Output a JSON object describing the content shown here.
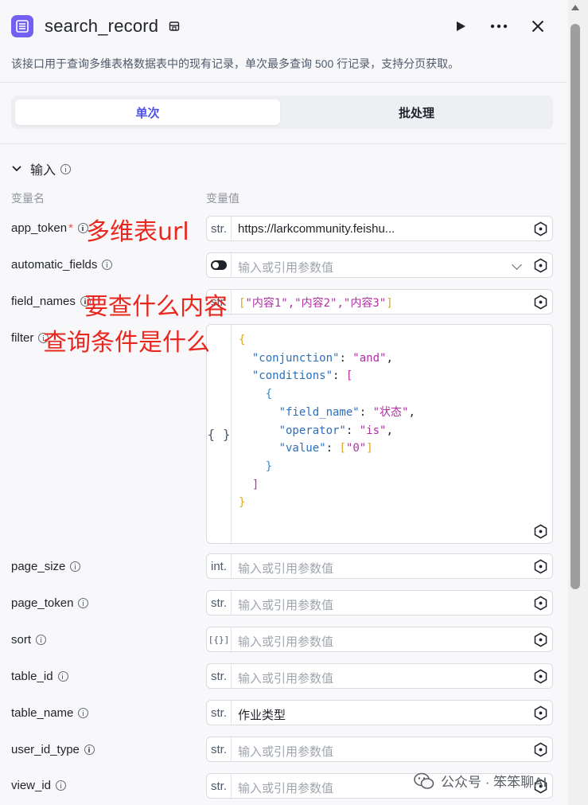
{
  "header": {
    "title": "search_record",
    "description": "该接口用于查询多维表格数据表中的现有记录，单次最多查询 500 行记录，支持分页获取。"
  },
  "tabs": [
    {
      "label": "单次",
      "active": true
    },
    {
      "label": "批处理",
      "active": false
    }
  ],
  "inputs_section": {
    "title": "输入",
    "col_name": "变量名",
    "col_value": "变量值"
  },
  "params": {
    "app_token": {
      "label": "app_token",
      "required": "*",
      "type": "str.",
      "value": "https://larkcommunity.feishu..."
    },
    "automatic_fields": {
      "label": "automatic_fields",
      "placeholder": "输入或引用参数值"
    },
    "field_names": {
      "label": "field_names",
      "type": "str.",
      "items": [
        "\"内容1\"",
        "\"内容2\"",
        "\"内容3\""
      ]
    },
    "filter": {
      "label": "filter",
      "type": "{ }",
      "json": {
        "conjunction_key": "\"conjunction\"",
        "conjunction_val": "\"and\"",
        "conditions_key": "\"conditions\"",
        "field_name_key": "\"field_name\"",
        "field_name_val": "\"状态\"",
        "operator_key": "\"operator\"",
        "operator_val": "\"is\"",
        "value_key": "\"value\"",
        "value_val": "\"0\""
      }
    },
    "page_size": {
      "label": "page_size",
      "type": "int.",
      "placeholder": "输入或引用参数值"
    },
    "page_token": {
      "label": "page_token",
      "type": "str.",
      "placeholder": "输入或引用参数值"
    },
    "sort": {
      "label": "sort",
      "type": "[{}]",
      "placeholder": "输入或引用参数值"
    },
    "table_id": {
      "label": "table_id",
      "type": "str.",
      "placeholder": "输入或引用参数值"
    },
    "table_name": {
      "label": "table_name",
      "type": "str.",
      "value": "作业类型"
    },
    "user_id_type": {
      "label": "user_id_type",
      "type": "str.",
      "placeholder": "输入或引用参数值"
    },
    "view_id": {
      "label": "view_id",
      "type": "str.",
      "placeholder": "输入或引用参数值"
    }
  },
  "annotations": {
    "app_token": "多维表url",
    "field_names": "要查什么内容",
    "filter": "查询条件是什么"
  },
  "watermark": "公众号 · 笨笨聊AI",
  "colors": {
    "accent": "#4d53e8",
    "annotation": "#e8271f",
    "app_icon": "#7360f2"
  }
}
